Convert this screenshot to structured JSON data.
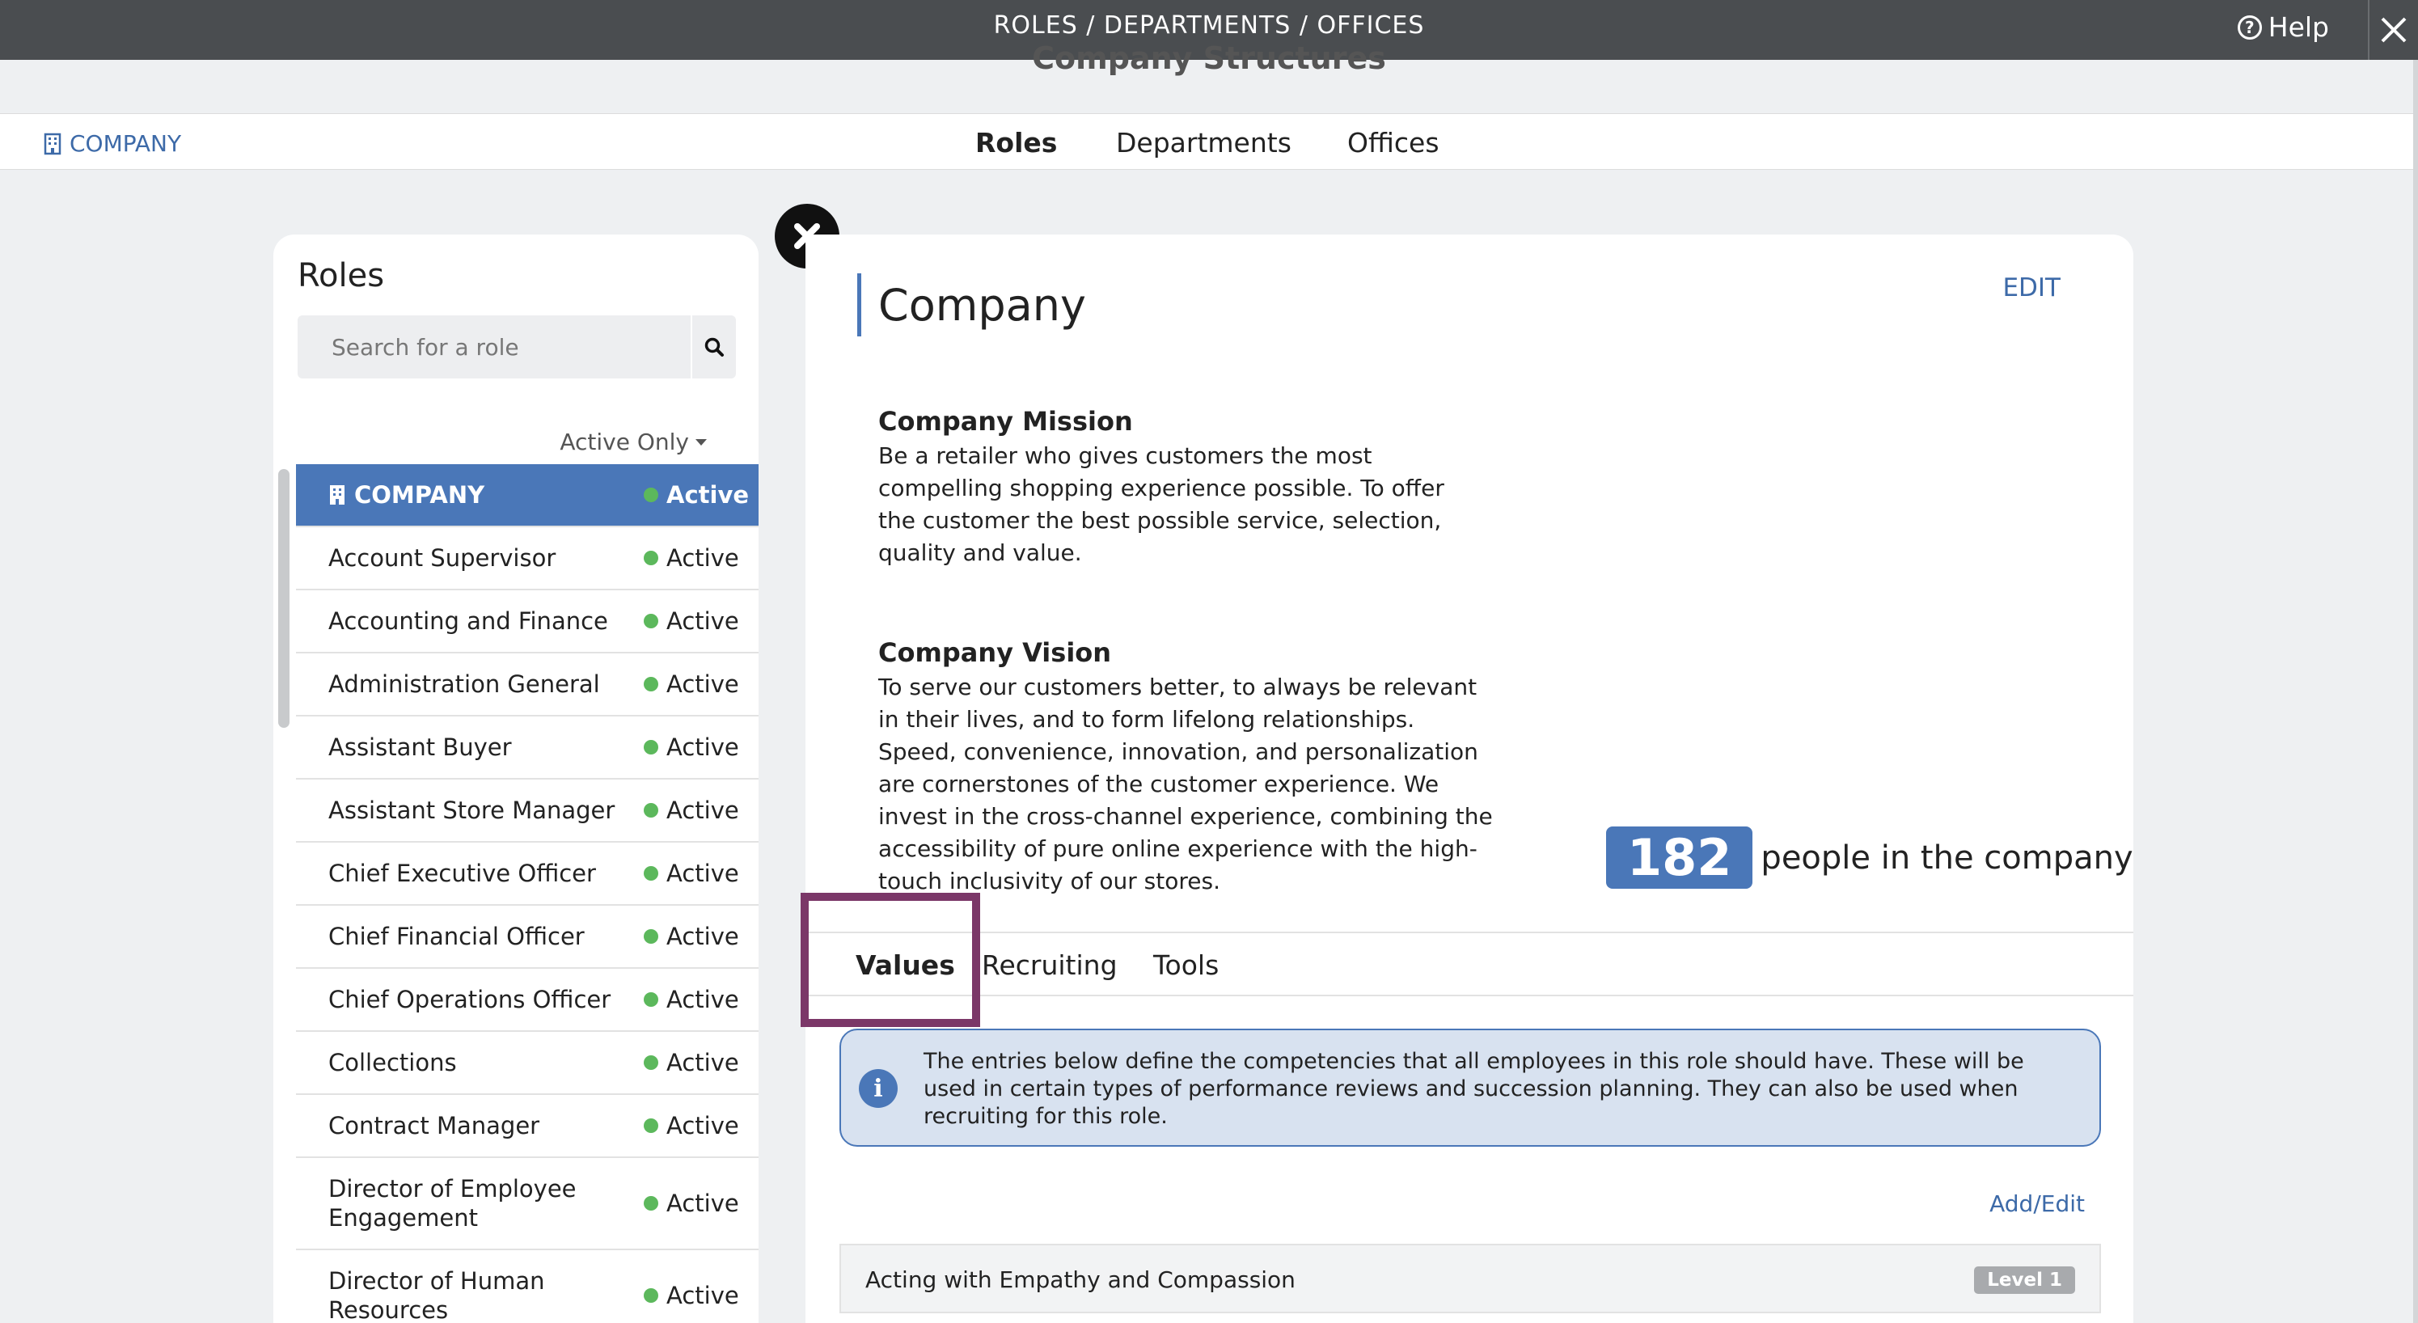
{
  "topbar": {
    "title": "ROLES / DEPARTMENTS / OFFICES",
    "help_label": "Help"
  },
  "page": {
    "partial_title": "Company Structures"
  },
  "nav": {
    "company_link": "COMPANY",
    "tabs": [
      {
        "label": "Roles",
        "active": true
      },
      {
        "label": "Departments",
        "active": false
      },
      {
        "label": "Offices",
        "active": false
      }
    ]
  },
  "roles_panel": {
    "title": "Roles",
    "search_placeholder": "Search for a role",
    "filter_label": "Active Only",
    "items": [
      {
        "name": "COMPANY",
        "status": "Active"
      },
      {
        "name": "Account Supervisor",
        "status": "Active"
      },
      {
        "name": "Accounting and Finance",
        "status": "Active"
      },
      {
        "name": "Administration General",
        "status": "Active"
      },
      {
        "name": "Assistant Buyer",
        "status": "Active"
      },
      {
        "name": "Assistant Store Manager",
        "status": "Active"
      },
      {
        "name": "Chief Executive Officer",
        "status": "Active"
      },
      {
        "name": "Chief Financial Officer",
        "status": "Active"
      },
      {
        "name": "Chief Operations Officer",
        "status": "Active"
      },
      {
        "name": "Collections",
        "status": "Active"
      },
      {
        "name": "Contract Manager",
        "status": "Active"
      },
      {
        "name": "Director of Employee Engagement",
        "status": "Active"
      },
      {
        "name": "Director of Human Resources",
        "status": "Active"
      }
    ]
  },
  "detail": {
    "title": "Company",
    "edit_label": "EDIT",
    "mission_heading": "Company Mission",
    "mission_text": "Be a retailer who gives customers the most compelling shopping experience possible. To offer the customer the best possible service, selection, quality and value.",
    "vision_heading": "Company Vision",
    "vision_text": "To serve our customers better, to always be relevant in their lives, and to form lifelong relationships. Speed, convenience, innovation, and personalization are cornerstones of the customer experience. We invest in the cross-channel experience, combining the accessibility of pure online experience with the high-touch inclusivity of our stores.",
    "people_count": "182",
    "people_label": "people in the company",
    "subtabs": [
      {
        "label": "Values",
        "active": true
      },
      {
        "label": "Recruiting",
        "active": false
      },
      {
        "label": "Tools",
        "active": false
      }
    ],
    "info_text": "The entries below define the competencies that all employees in this role should have. These will be used in certain types of performance reviews and succession planning. They can also be used when recruiting for this role.",
    "add_edit_label": "Add/Edit",
    "values": [
      {
        "name": "Acting with Empathy and Compassion",
        "level": "Level 1"
      }
    ]
  },
  "colors": {
    "accent": "#4a77b8",
    "active_dot": "#5cb85c",
    "highlight": "#7b3768",
    "topbar": "#4a4d50"
  }
}
